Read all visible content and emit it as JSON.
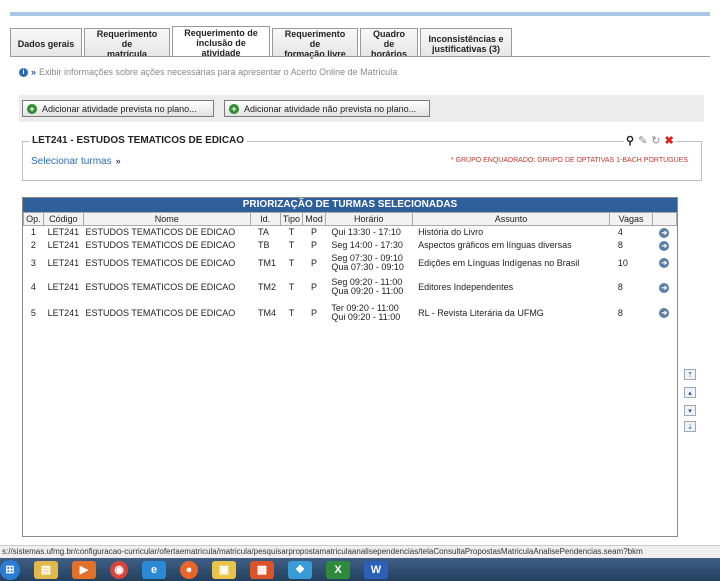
{
  "tabs": [
    {
      "label": "Dados gerais",
      "active": false
    },
    {
      "label": "Requerimento de\nmatrícula",
      "active": false
    },
    {
      "label": "Requerimento de\ninclusão de atividade",
      "active": true
    },
    {
      "label": "Requerimento de\nformação livre",
      "active": false
    },
    {
      "label": "Quadro de\nhorários",
      "active": false
    },
    {
      "label": "Inconsistências e\njustificativas (3)",
      "active": false
    }
  ],
  "info_text": "Exibir informações sobre ações necessárias para apresentar o Acerto Online de Matrícula",
  "actions": {
    "add_planned": "Adicionar atividade prevista no plano...",
    "add_unplanned": "Adicionar atividade não prevista no plano..."
  },
  "course": {
    "title": "LET241 - ESTUDOS TEMATICOS DE EDICAO",
    "select_label": "Selecionar turmas",
    "group_text": "* GRUPO ENQUADRADO: GRUPO DE OPTATIVAS 1-BACH PORTUGUES"
  },
  "table": {
    "title": "PRIORIZAÇÃO DE TURMAS SELECIONADAS",
    "headers": [
      "Op.",
      "Código",
      "Nome",
      "Id.",
      "Tipo",
      "Mod",
      "Horário",
      "Assunto",
      "Vagas",
      ""
    ],
    "rows": [
      {
        "op": "1",
        "codigo": "LET241",
        "nome": "ESTUDOS TEMATICOS DE EDICAO",
        "id": "TA",
        "tipo": "T",
        "mod": "P",
        "horario": "Qui 13:30 - 17:10",
        "assunto": "História do Livro",
        "vagas": "4"
      },
      {
        "op": "2",
        "codigo": "LET241",
        "nome": "ESTUDOS TEMATICOS DE EDICAO",
        "id": "TB",
        "tipo": "T",
        "mod": "P",
        "horario": "Seg 14:00 - 17:30",
        "assunto": "Aspectos gráficos em línguas diversas",
        "vagas": "8"
      },
      {
        "op": "3",
        "codigo": "LET241",
        "nome": "ESTUDOS TEMATICOS DE EDICAO",
        "id": "TM1",
        "tipo": "T",
        "mod": "P",
        "horario": "Seg 07:30 - 09:10\nQua 07:30 - 09:10",
        "assunto": "Edições em Línguas Indígenas no Brasil",
        "vagas": "10"
      },
      {
        "op": "4",
        "codigo": "LET241",
        "nome": "ESTUDOS TEMATICOS DE EDICAO",
        "id": "TM2",
        "tipo": "T",
        "mod": "P",
        "horario": "Seg 09:20 - 11:00\nQua 09:20 - 11:00",
        "assunto": "Editores Independentes",
        "vagas": "8"
      },
      {
        "op": "5",
        "codigo": "LET241",
        "nome": "ESTUDOS TEMATICOS DE EDICAO",
        "id": "TM4",
        "tipo": "T",
        "mod": "P",
        "horario": "Ter 09:20 - 11:00\nQui 09:20 - 11:00",
        "assunto": "RL - Revista Literária da UFMG",
        "vagas": "8"
      }
    ]
  },
  "scroll_buttons": [
    "⇡",
    "▴",
    "▾",
    "⇣"
  ],
  "status_url": "s://sistemas.ufmg.br/configuracao-curricular/ofertaematricula/matricula/pesquisarpropostamatriculaanalisependencias/telaConsultaPropostasMatriculaAnalisePendencias.seam?bkm",
  "taskbar_icons": [
    {
      "name": "start-orb-icon",
      "glyph": "⊞",
      "color": "#2a7fd4"
    },
    {
      "name": "file-explorer-icon",
      "glyph": "▤",
      "color": "#e1b84a"
    },
    {
      "name": "media-player-icon",
      "glyph": "▶",
      "color": "#e0702a"
    },
    {
      "name": "chrome-icon",
      "glyph": "◉",
      "color": "#d9453b"
    },
    {
      "name": "internet-explorer-icon",
      "glyph": "e",
      "color": "#2b8ad6"
    },
    {
      "name": "firefox-icon",
      "glyph": "●",
      "color": "#e8662a"
    },
    {
      "name": "folder-icon",
      "glyph": "▣",
      "color": "#e8c34a"
    },
    {
      "name": "document-icon",
      "glyph": "▦",
      "color": "#d9542b"
    },
    {
      "name": "network-icon",
      "glyph": "❖",
      "color": "#3a9bd9"
    },
    {
      "name": "excel-icon",
      "glyph": "X",
      "color": "#2e8b3c"
    },
    {
      "name": "word-icon",
      "glyph": "W",
      "color": "#2b5fb8"
    }
  ]
}
